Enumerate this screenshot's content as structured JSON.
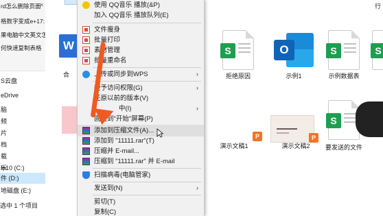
{
  "sidebar": {
    "recent_items": [
      {
        "label": "rd怎么删除页面"
      },
      {
        "label": "格数字变成e+17:"
      },
      {
        "label": "果电脑中文英文怎"
      },
      {
        "label": "何快速复制表格"
      }
    ],
    "nav_items": [
      {
        "label": "S云盘"
      },
      {
        "label": "eDrive"
      },
      {
        "label": "脑"
      },
      {
        "label": "频"
      },
      {
        "label": "片"
      },
      {
        "label": "档"
      },
      {
        "label": "载"
      },
      {
        "label": "乐"
      },
      {
        "label": "面"
      },
      {
        "label": "in10 (C:)"
      },
      {
        "label": "件 (D:)"
      },
      {
        "label": "地磁盘 (E:)"
      }
    ]
  },
  "status_bar": {
    "selected_text": "选中 1 个项目"
  },
  "files": {
    "row1": [
      {
        "label": "合"
      },
      {
        "label": "拒绝原因"
      },
      {
        "label": "示例1"
      },
      {
        "label": "示例数据表"
      }
    ],
    "row2": [
      {
        "label": "演示文稿1"
      },
      {
        "label": "演示文稿2"
      },
      {
        "label": "要发送的文件"
      }
    ],
    "partial_right_top": "行"
  },
  "context_menu": {
    "items": [
      {
        "label": "使用 QQ音乐 播放(&P)",
        "icon": "qq-music-icon"
      },
      {
        "label": "加入 QQ音乐 播放队列(E)",
        "icon": "none"
      },
      {
        "label": "文件瘦身",
        "icon": "wps-icon"
      },
      {
        "label": "批量打印",
        "icon": "wps-icon"
      },
      {
        "label": "素材管理",
        "icon": "wps-icon"
      },
      {
        "label": "批量重命名",
        "icon": "wps-icon"
      },
      {
        "label": "上传或同步到WPS",
        "icon": "cloud-icon",
        "submenu": "›"
      },
      {
        "label": "授予访问权限(G)",
        "icon": "none",
        "submenu": "›"
      },
      {
        "label": "还原以前的版本(V)",
        "icon": "none"
      },
      {
        "label": "固定到\"开始\"屏幕(P)",
        "icon": "none"
      },
      {
        "label": "添加到压缩文件(A)...",
        "icon": "winrar-icon"
      },
      {
        "label": "添加到 \"11111.rar\"(T)",
        "icon": "winrar-icon"
      },
      {
        "label": "压缩并 E-mail...",
        "icon": "winrar-icon"
      },
      {
        "label": "压缩到 \"11111.rar\" 并 E-mail",
        "icon": "winrar-icon"
      },
      {
        "label": "扫描病毒(电脑管家)",
        "icon": "shield-icon"
      },
      {
        "label": "发送到(N)",
        "icon": "none",
        "submenu": "›"
      },
      {
        "label": "剪切(T)",
        "icon": "none"
      },
      {
        "label": "复制(C)",
        "icon": "none"
      }
    ],
    "partial_label_row9": "中(I)"
  },
  "colors": {
    "accent_arrow": "#f05a22",
    "selection": "#cce8ff",
    "menu_bg": "#f1f1f1"
  }
}
